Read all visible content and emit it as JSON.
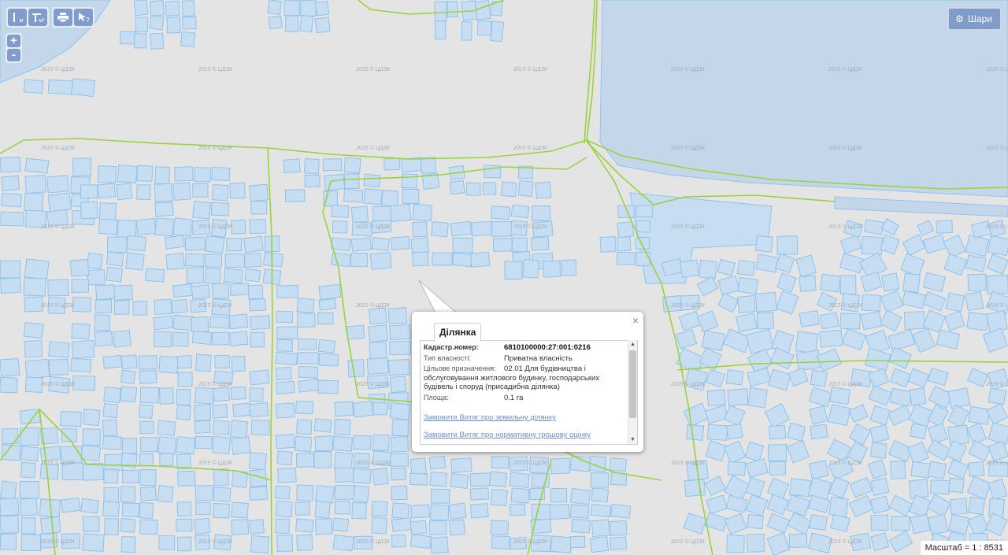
{
  "toolbar": {
    "measure_length_label": "м",
    "measure_area_label": "м²",
    "print_icon": "printer-icon",
    "identify_icon": "pointer-question-icon"
  },
  "zoom": {
    "in_label": "+",
    "out_label": "-"
  },
  "layers_button": {
    "label": "Шари",
    "icon": "gear-icon"
  },
  "watermark": "2015 © ЦДЗК",
  "scale": {
    "text": "Масштаб = 1 : 8531"
  },
  "popup": {
    "tab_label": "Ділянка",
    "close_label": "×",
    "fields": {
      "cadastral_label": "Кадастр.номер:",
      "cadastral_value": "6810100000:27:001:0216",
      "ownership_label": "Тип власності:",
      "ownership_value": "Приватна власність",
      "purpose_label": "Цільове призначення:",
      "purpose_value": "02.01 Для будівництва і обслуговування житлового будинку, господарських будівель і споруд (присадибна ділянка)",
      "area_label": "Площа:",
      "area_value": "0.1 га"
    },
    "links": {
      "order_land": "Замовити Витяг про земельну ділянку",
      "order_valuation": "Замовити Витяг про нормативну грошову оцінку"
    }
  },
  "colors": {
    "map_bg": "#e4e4e4",
    "parcel_fill": "#c6ddf2",
    "parcel_stroke": "#8fc3ec",
    "water": "#c4d7ea",
    "boundary": "#9bd23c",
    "control_bg": "#7f9ccb",
    "link": "#6e8ed1"
  }
}
